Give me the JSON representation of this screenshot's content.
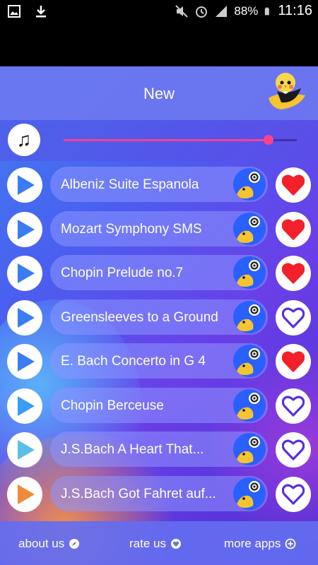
{
  "status": {
    "battery": "88%",
    "time": "11:16"
  },
  "header": {
    "title": "New"
  },
  "player": {
    "progress": 0.88
  },
  "songs": [
    {
      "name": "Albeniz Suite Espanola",
      "favorite": true,
      "play_color": "#3a7cf2"
    },
    {
      "name": "Mozart Symphony SMS",
      "favorite": true,
      "play_color": "#3a7cf2"
    },
    {
      "name": "Chopin Prelude no.7",
      "favorite": true,
      "play_color": "#3a7cf2"
    },
    {
      "name": "Greensleeves to a Ground",
      "favorite": false,
      "play_color": "#3a7cf2"
    },
    {
      "name": "E. Bach Concerto in G 4",
      "favorite": true,
      "play_color": "#3a7cf2"
    },
    {
      "name": "Chopin Berceuse",
      "favorite": false,
      "play_color": "#3a9cf2"
    },
    {
      "name": "J.S.Bach A Heart That...",
      "favorite": false,
      "play_color": "#5abfe8"
    },
    {
      "name": "J.S.Bach Got Fahret auf...",
      "favorite": false,
      "play_color": "#f08a3a"
    }
  ],
  "colors": {
    "heart_full": "#f2202a",
    "heart_empty": "#5a2fe0",
    "accent": "#ff3f8f"
  },
  "footer": {
    "about": "about us",
    "rate": "rate us",
    "more": "more apps"
  }
}
